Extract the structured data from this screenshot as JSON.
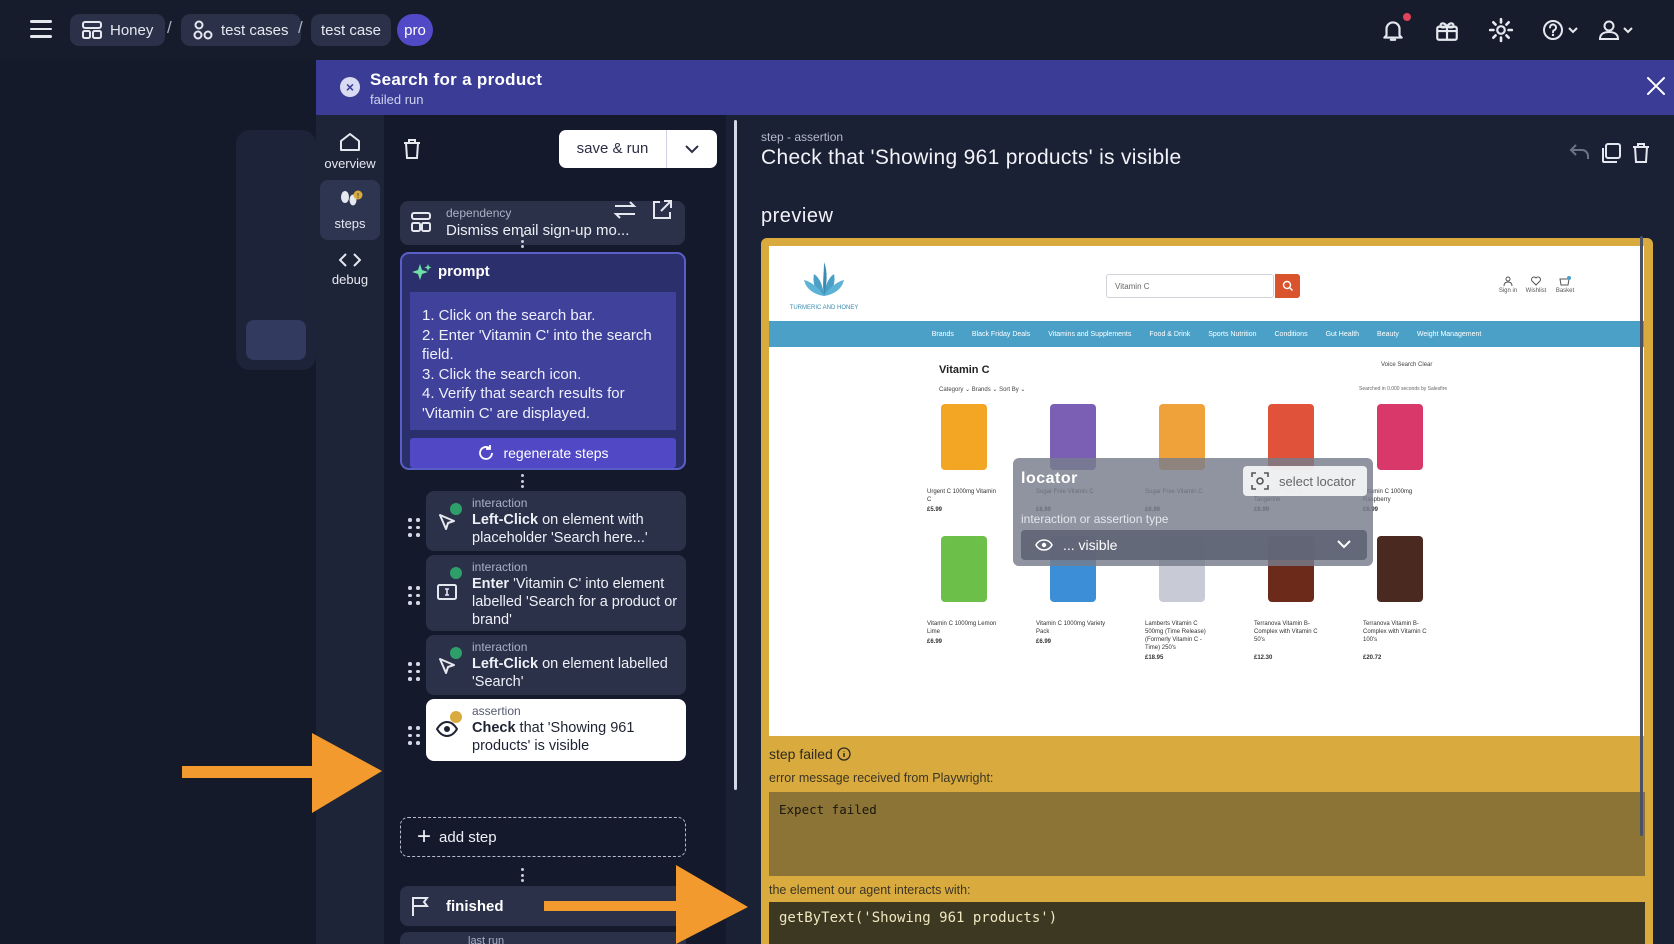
{
  "topbar": {
    "breadcrumbs": [
      "Honey",
      "test cases",
      "test case"
    ],
    "separator": "/",
    "plan_badge": "pro"
  },
  "panel": {
    "title": "Search for a product",
    "subtitle": "failed run"
  },
  "vnav": [
    {
      "label": "overview",
      "icon": "home-icon"
    },
    {
      "label": "steps",
      "icon": "footsteps-icon"
    },
    {
      "label": "debug",
      "icon": "code-icon"
    }
  ],
  "toolbar": {
    "save_run_label": "save & run"
  },
  "dependency": {
    "label": "dependency",
    "name": "Dismiss email sign-up mo..."
  },
  "prompt": {
    "title": "prompt",
    "lines": [
      "1. Click on the search bar.",
      "2. Enter 'Vitamin C' into the search field.",
      "3. Click the search icon.",
      "4. Verify that search results for 'Vitamin C' are displayed."
    ],
    "regenerate_label": "regenerate steps"
  },
  "steps": [
    {
      "type": "interaction",
      "action": "Left-Click",
      "rest": " on element with placeholder 'Search here...'",
      "status": "passed"
    },
    {
      "type": "interaction",
      "action": "Enter",
      "rest": " 'Vitamin C' into element labelled 'Search for a product or brand'",
      "status": "passed"
    },
    {
      "type": "interaction",
      "action": "Left-Click",
      "rest": " on element labelled 'Search'",
      "status": "passed"
    },
    {
      "type": "assertion",
      "action": "Check",
      "rest": " that 'Showing 961 products' is visible",
      "status": "failed"
    }
  ],
  "add_step_label": "add step",
  "finished_label": "finished",
  "last_run_label": "last run",
  "detail": {
    "kind": "step - assertion",
    "title": "Check that 'Showing 961 products' is visible",
    "preview_label": "preview",
    "step_failed_label": "step failed",
    "error_label": "error message received from Playwright:",
    "error_message": "Expect failed",
    "element_label": "the element our agent interacts with:",
    "element_code": "getByText('Showing 961 products')"
  },
  "locator_popup": {
    "title": "locator",
    "select_label": "select locator",
    "type_label": "interaction or assertion type",
    "type_value": "... visible"
  },
  "site": {
    "brand": "TURMERIC AND HONEY",
    "search_value": "Vitamin C",
    "icons": [
      "Sign in",
      "Wishlist",
      "Basket"
    ],
    "nav": [
      "Brands",
      "Black Friday Deals",
      "Vitamins and Supplements",
      "Food & Drink",
      "Sports Nutrition",
      "Conditions",
      "Gut Health",
      "Beauty",
      "Weight Management"
    ],
    "heading": "Vitamin C",
    "filters": "Category ⌄   Brands ⌄   Sort By ⌄",
    "voice": "Voice Search    Clear",
    "meta": "Searched in 0.000 seconds by Salesfire",
    "products_row1": [
      {
        "name": "Urgent C 1000mg Vitamin C",
        "price": "£5.99",
        "color": "#f2a623"
      },
      {
        "name": "Sugar Free Vitamin C",
        "price": "£6.99",
        "color": "#7a5fb5"
      },
      {
        "name": "Sugar Free Vitamin C",
        "price": "£6.99",
        "color": "#f0a23a"
      },
      {
        "name": "Vitamin C 1000mg Tangerine",
        "price": "£6.99",
        "color": "#e0533a"
      },
      {
        "name": "Vitamin C 1000mg Raspberry",
        "price": "£6.99",
        "color": "#d9386a"
      }
    ],
    "products_row2": [
      {
        "name": "Vitamin C 1000mg Lemon Lime",
        "price": "£6.99",
        "color": "#6cc04a"
      },
      {
        "name": "Vitamin C 1000mg Variety Pack",
        "price": "£6.99",
        "color": "#3c8ed6"
      },
      {
        "name": "Lamberts Vitamin C 500mg (Time Release) (Formerly Vitamin C - Time) 250's",
        "price": "£18.95",
        "color": "#c8cbd6"
      },
      {
        "name": "Terranova Vitamin B-Complex with Vitamin C 50's",
        "price": "£12.30",
        "color": "#6b2a1a"
      },
      {
        "name": "Terranova Vitamin B-Complex with Vitamin C 100's",
        "price": "£20.72",
        "color": "#4a2a20"
      }
    ]
  },
  "colors": {
    "accent": "#5149c6",
    "panel_header": "#3a3c95",
    "failed": "#d9ab3e",
    "arrow": "#f29a2e"
  }
}
